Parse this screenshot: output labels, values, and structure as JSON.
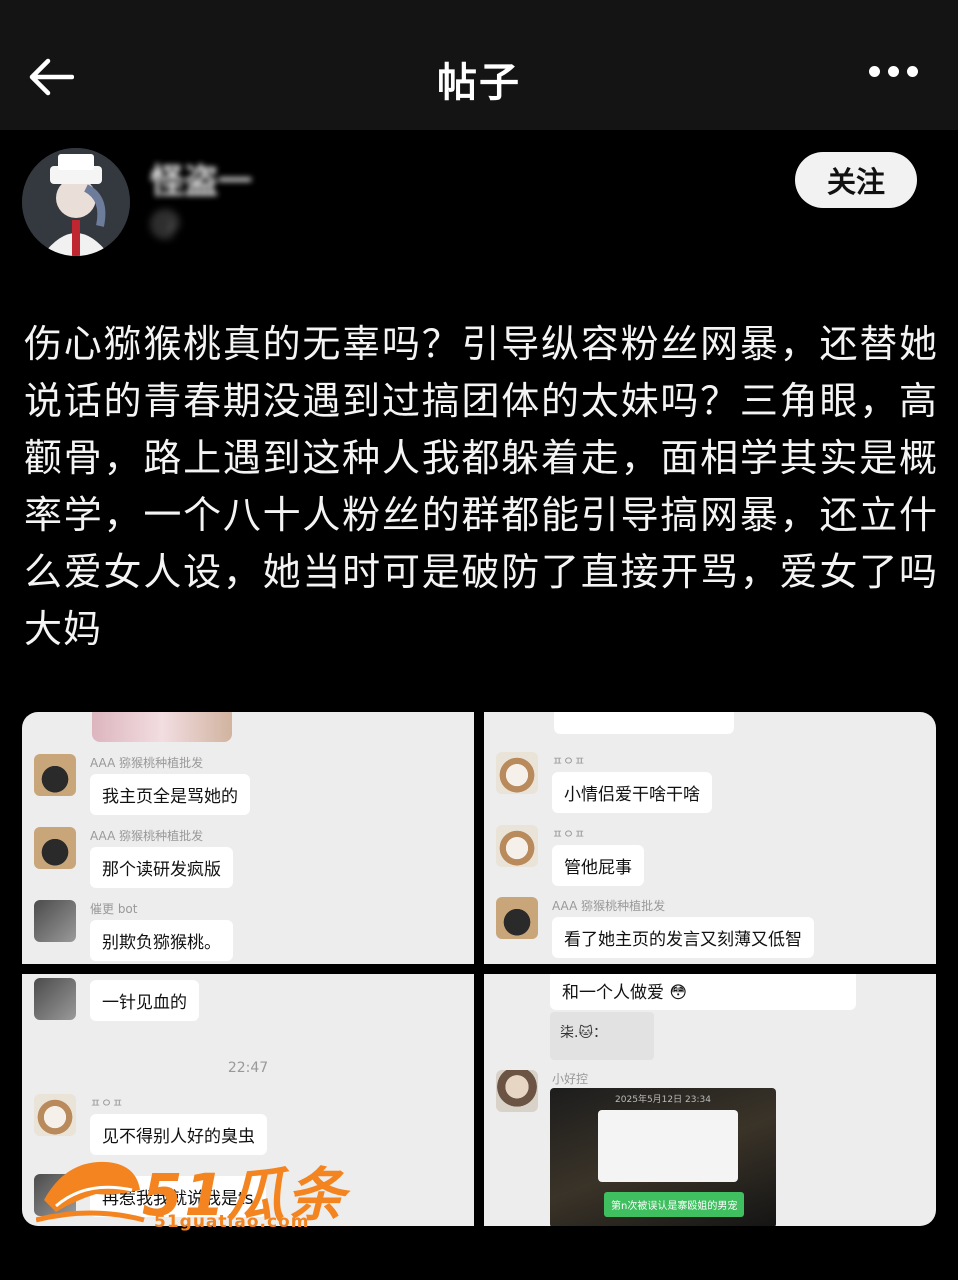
{
  "topbar": {
    "title": "帖子"
  },
  "author": {
    "name": "怪盗一",
    "handle": "@",
    "follow_label": "关注"
  },
  "post": {
    "text": "伤心猕猴桃真的无辜吗？引导纵容粉丝网暴，还替她说话的青春期没遇到过搞团体的太妹吗？三角眼，高颧骨，路上遇到这种人我都躲着走，面相学其实是概率学，一个八十人粉丝的群都能引导搞网暴，还立什么爱女人设，她当时可是破防了直接开骂，爱女了吗大妈"
  },
  "images": {
    "c1": {
      "msgs": [
        {
          "name": "AAA 猕猴桃种植批发",
          "text": "我主页全是骂她的"
        },
        {
          "name": "AAA 猕猴桃种植批发",
          "text": "那个读研发疯版"
        },
        {
          "name": "催更 bot",
          "text": "别欺负猕猴桃。"
        }
      ]
    },
    "c2": {
      "msgs": [
        {
          "name": "ㅍㅇㅍ",
          "text": "小情侣爱干啥干啥"
        },
        {
          "name": "ㅍㅇㅍ",
          "text": "管他屁事"
        },
        {
          "name": "AAA 猕猴桃种植批发",
          "text": "看了她主页的发言又刻薄又低智"
        }
      ]
    },
    "c3": {
      "first_text": "一针见血的",
      "time": "22:47",
      "msg_name": "ㅍㅇㅍ",
      "msg_text": "见不得别人好的臭虫",
      "last_text": "再惹我我就说我是ts"
    },
    "c4": {
      "top_text": "和一个人做爱 😳",
      "quote_text": "柒.🐱：",
      "msg_name": "小好控",
      "img_date": "2025年5月12日 23:34",
      "green_text": "第n次被误认是寨殴姐的男宠"
    }
  },
  "watermark": {
    "brand": "51瓜条",
    "url": "51guatiao.com"
  },
  "colors": {
    "background": "#000000",
    "topbar": "#141414",
    "follow_bg": "#f2f2f2",
    "watermark": "#f3841f"
  }
}
